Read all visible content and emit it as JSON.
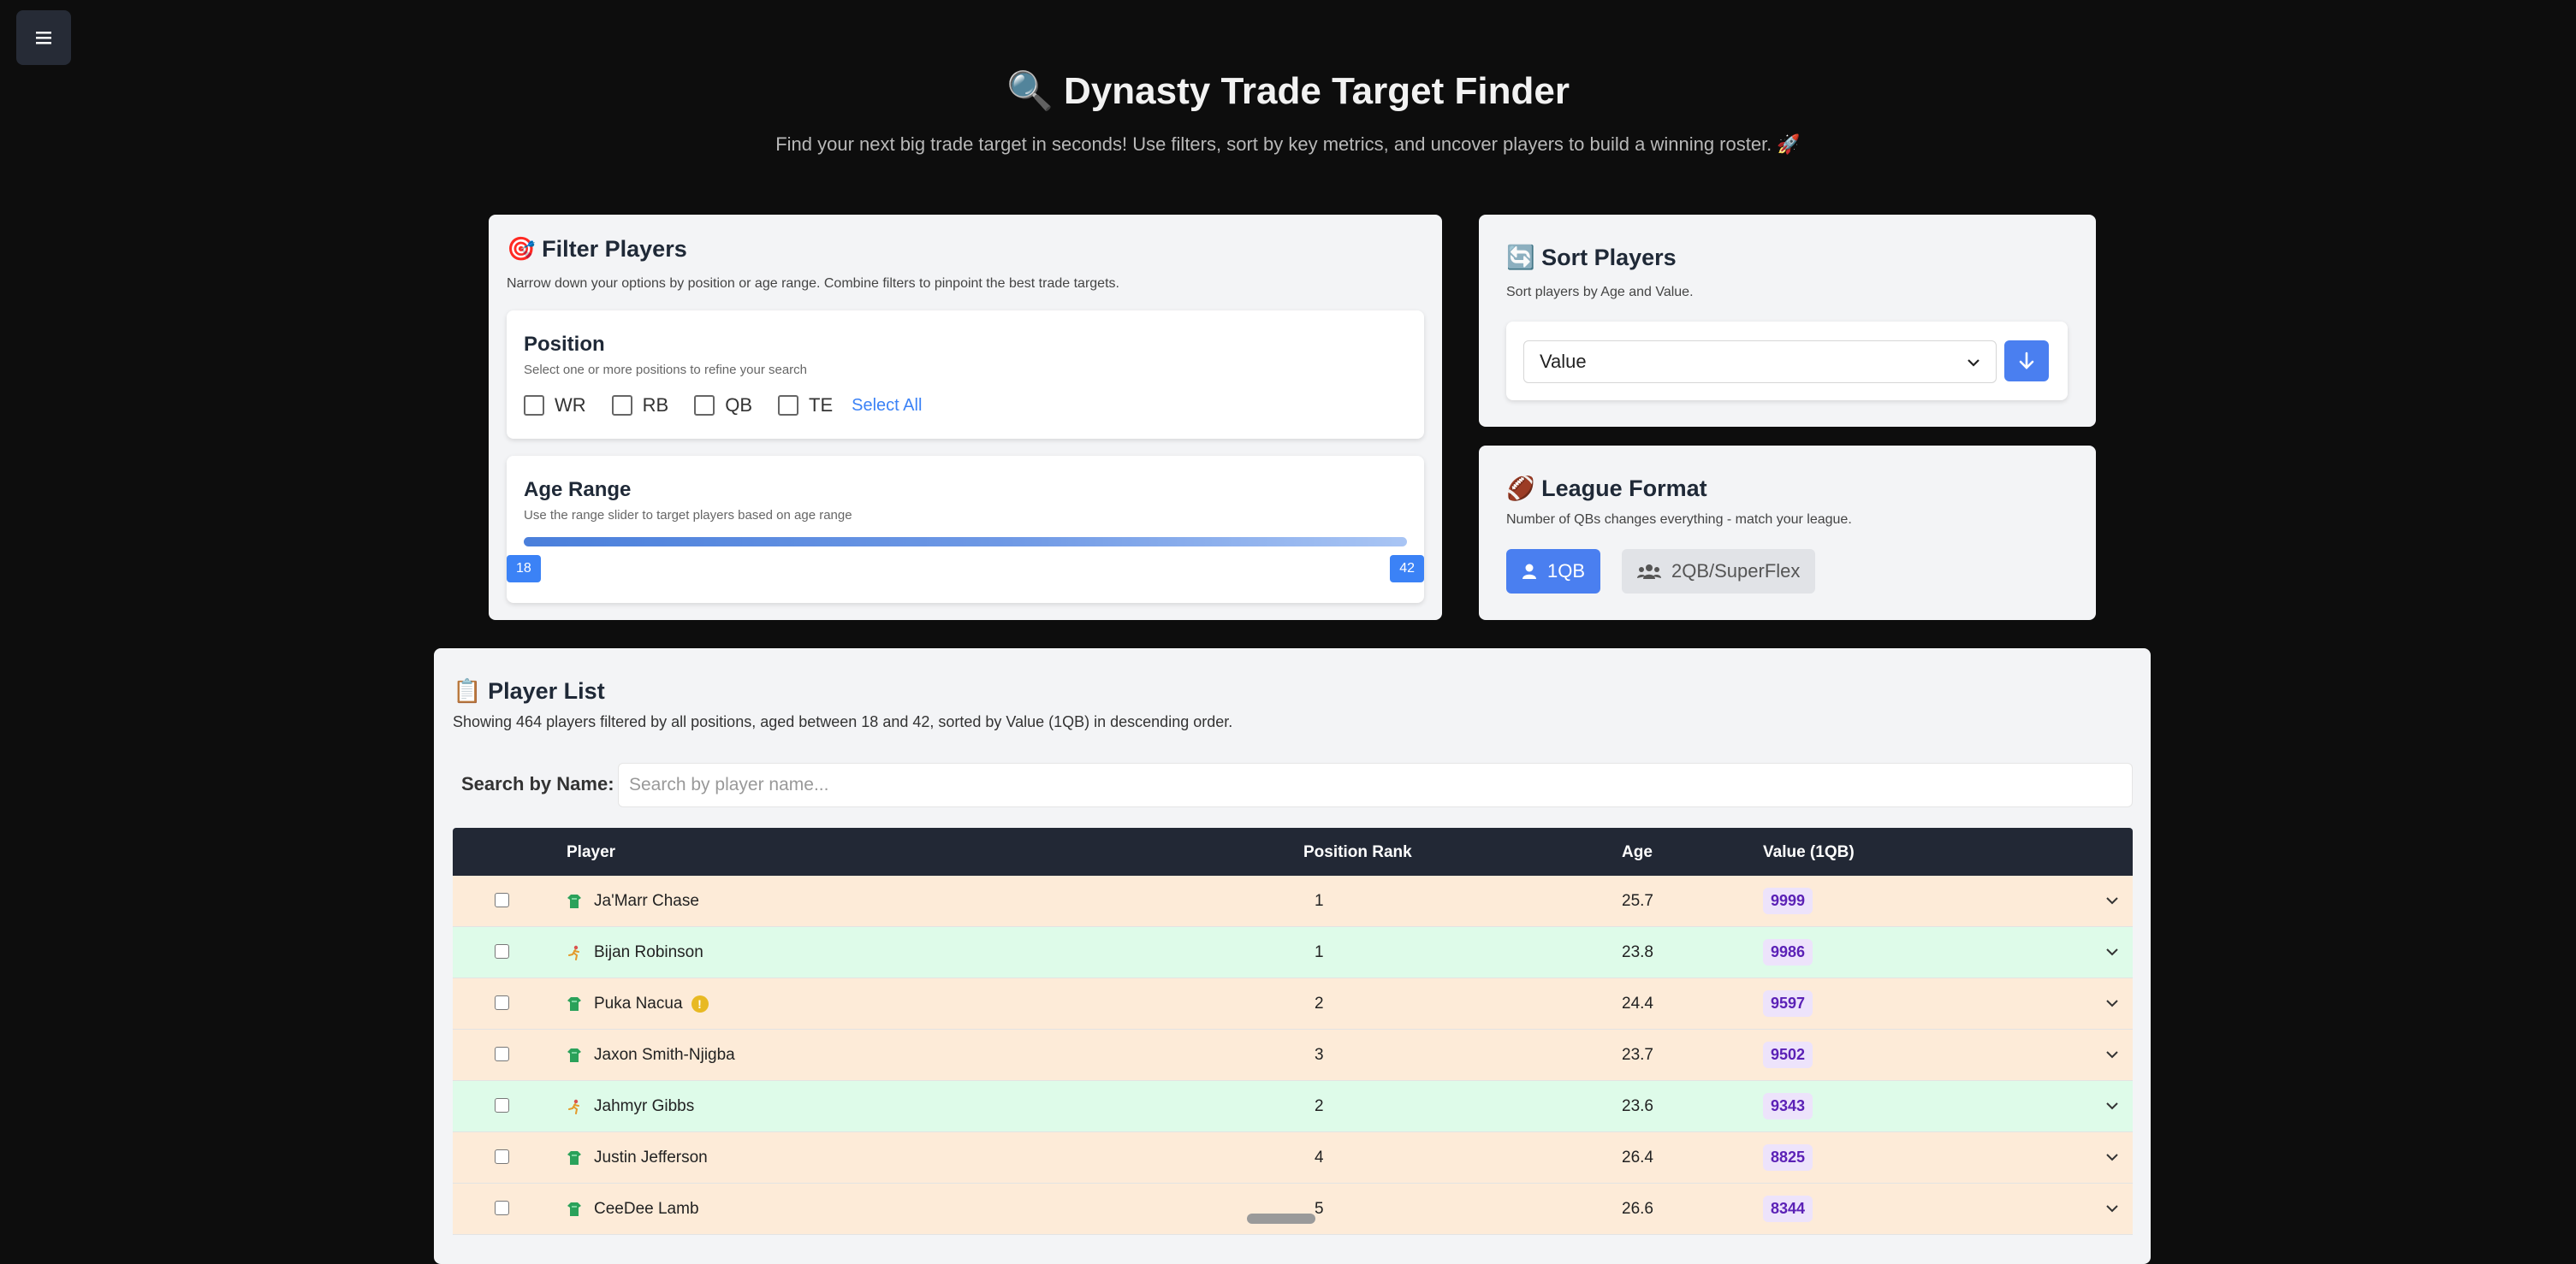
{
  "header": {
    "title": "🔍 Dynasty Trade Target Finder",
    "subtitle": "Find your next big trade target in seconds! Use filters, sort by key metrics, and uncover players to build a winning roster. 🚀"
  },
  "filter": {
    "title": "🎯 Filter Players",
    "description": "Narrow down your options by position or age range. Combine filters to pinpoint the best trade targets.",
    "position": {
      "title": "Position",
      "description": "Select one or more positions to refine your search",
      "options": [
        "WR",
        "RB",
        "QB",
        "TE"
      ],
      "select_all": "Select All"
    },
    "age": {
      "title": "Age Range",
      "description": "Use the range slider to target players based on age range",
      "min_label": "18",
      "max_label": "42"
    }
  },
  "sort": {
    "title": "🔄 Sort Players",
    "description": "Sort players by Age and Value.",
    "selected": "Value"
  },
  "league": {
    "title": "🏈 League Format",
    "description": "Number of QBs changes everything - match your league.",
    "option_1qb": "1QB",
    "option_sf": "2QB/SuperFlex"
  },
  "list": {
    "title": "📋 Player List",
    "summary": "Showing 464 players filtered by all positions, aged between 18 and 42, sorted by Value (1QB) in descending order.",
    "search_label": "Search by Name:",
    "search_placeholder": "Search by player name...",
    "columns": {
      "player": "Player",
      "rank": "Position Rank",
      "age": "Age",
      "value": "Value (1QB)"
    },
    "rows": [
      {
        "name": "Ja'Marr Chase",
        "pos": "WR",
        "rank": "1",
        "age": "25.7",
        "value": "9999",
        "icon": "jersey-icon",
        "warn": false
      },
      {
        "name": "Bijan Robinson",
        "pos": "RB",
        "rank": "1",
        "age": "23.8",
        "value": "9986",
        "icon": "runner-icon",
        "warn": false
      },
      {
        "name": "Puka Nacua",
        "pos": "WR",
        "rank": "2",
        "age": "24.4",
        "value": "9597",
        "icon": "jersey-icon",
        "warn": true
      },
      {
        "name": "Jaxon Smith-Njigba",
        "pos": "WR",
        "rank": "3",
        "age": "23.7",
        "value": "9502",
        "icon": "jersey-icon",
        "warn": false
      },
      {
        "name": "Jahmyr Gibbs",
        "pos": "RB",
        "rank": "2",
        "age": "23.6",
        "value": "9343",
        "icon": "runner-icon",
        "warn": false
      },
      {
        "name": "Justin Jefferson",
        "pos": "WR",
        "rank": "4",
        "age": "26.4",
        "value": "8825",
        "icon": "jersey-icon",
        "warn": false
      },
      {
        "name": "CeeDee Lamb",
        "pos": "WR",
        "rank": "5",
        "age": "26.6",
        "value": "8344",
        "icon": "jersey-icon",
        "warn": false
      }
    ]
  },
  "colors": {
    "accent": "#4a7ff0",
    "wr_row": "#fdebd8",
    "rb_row": "#defbe9",
    "value_badge_text": "#5b21b6"
  }
}
